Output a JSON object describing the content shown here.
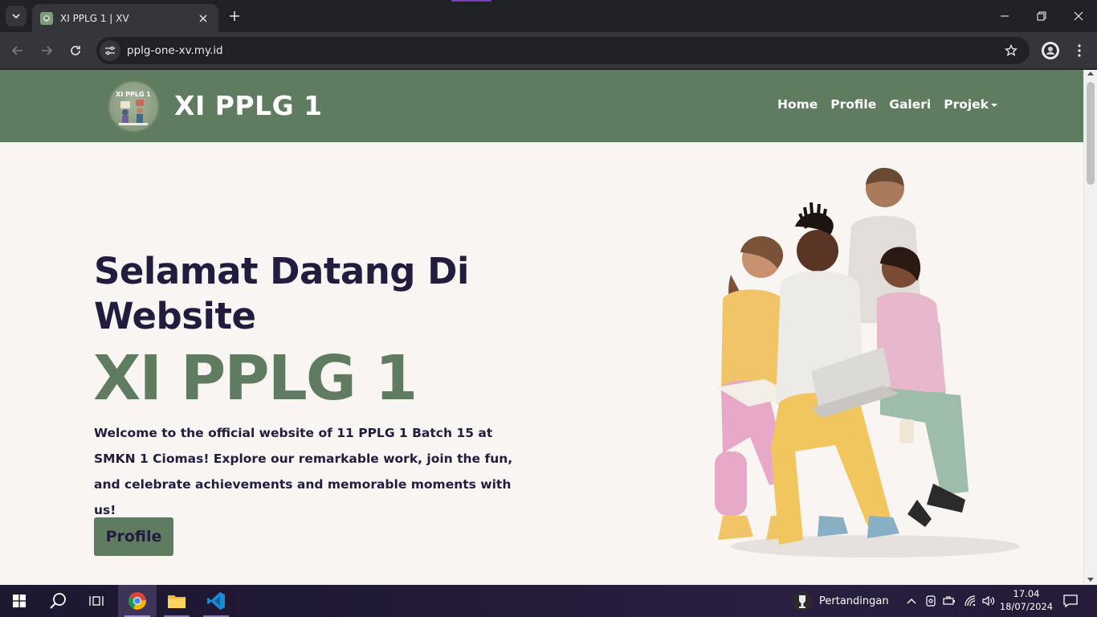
{
  "browser": {
    "tab_title": "XI PPLG 1 | XV",
    "url": "pplg-one-xv.my.id"
  },
  "site": {
    "brand": "XI PPLG 1",
    "logo_text": "XI PPLG 1",
    "nav": {
      "home": "Home",
      "profile": "Profile",
      "galeri": "Galeri",
      "projek": "Projek"
    },
    "colors": {
      "primary": "#5f7b60",
      "heading": "#241c3e",
      "background": "#f8f5f2"
    }
  },
  "hero": {
    "heading": "Selamat Datang Di Website",
    "accent": "XI PPLG 1",
    "description": "Welcome to the official website of 11 PPLG 1 Batch 15 at SMKN 1 Ciomas! Explore our remarkable work, join the fun, and celebrate achievements and memorable moments with us!",
    "button_label": "Profile"
  },
  "taskbar": {
    "weather_label": "Pertandingan",
    "time": "17.04",
    "date": "18/07/2024"
  }
}
